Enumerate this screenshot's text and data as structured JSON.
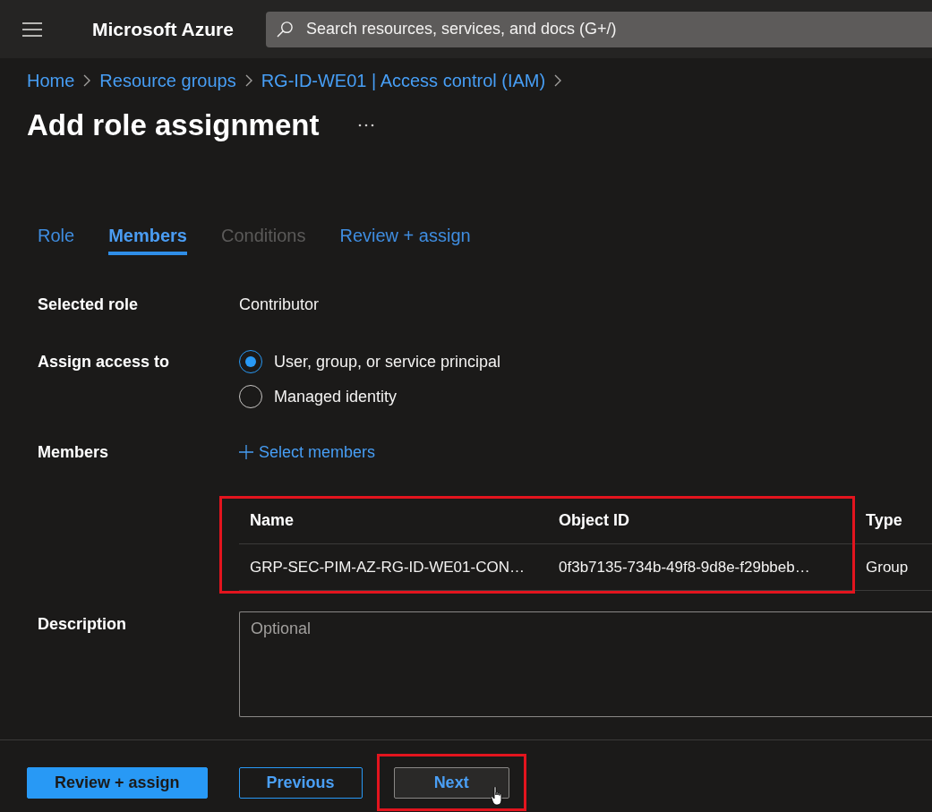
{
  "top_bar": {
    "title": "Microsoft Azure",
    "search": {
      "placeholder": "Search resources, services, and docs (G+/)"
    }
  },
  "breadcrumb": [
    "Home",
    "Resource groups",
    "RG-ID-WE01 | Access control (IAM)"
  ],
  "page": {
    "title": "Add role assignment"
  },
  "tabs": [
    {
      "label": "Role",
      "selected": false,
      "disabled": false
    },
    {
      "label": "Members",
      "selected": true,
      "disabled": false
    },
    {
      "label": "Conditions",
      "selected": false,
      "disabled": true
    },
    {
      "label": "Review + assign",
      "selected": false,
      "disabled": false
    }
  ],
  "form": {
    "selected_role": {
      "label": "Selected role",
      "value": "Contributor"
    },
    "assign_access_to": {
      "label": "Assign access to",
      "options": [
        {
          "label": "User, group, or service principal",
          "selected": true
        },
        {
          "label": "Managed identity",
          "selected": false
        }
      ]
    },
    "members": {
      "label": "Members",
      "action": "Select members",
      "table": {
        "highlighted": true,
        "columns": [
          "Name",
          "Object ID",
          "Type"
        ],
        "rows": [
          [
            "GRP-SEC-PIM-AZ-RG-ID-WE01-CON…",
            "0f3b7135-734b-49f8-9d8e-f29bbeb…",
            "Group"
          ]
        ]
      }
    },
    "description": {
      "label": "Description",
      "placeholder": "Optional"
    }
  },
  "footer": {
    "buttons": [
      {
        "label": "Review + assign",
        "kind": "primary",
        "highlighted": false
      },
      {
        "label": "Previous",
        "kind": "outline",
        "highlighted": false
      },
      {
        "label": "Next",
        "kind": "default",
        "highlighted": true
      }
    ]
  }
}
